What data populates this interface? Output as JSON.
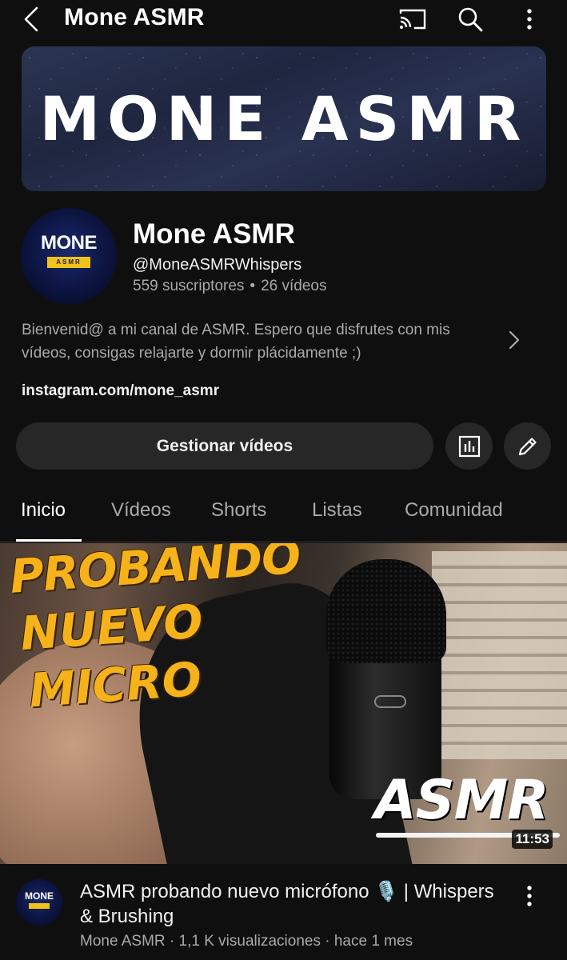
{
  "header": {
    "title": "Mone ASMR",
    "icons": [
      "back-arrow-icon",
      "cast-icon",
      "search-icon",
      "more-vertical-icon"
    ]
  },
  "banner": {
    "text": "MONE ASMR"
  },
  "channel": {
    "avatar_name": "MONE",
    "avatar_tag": "ASMR",
    "name": "Mone ASMR",
    "handle": "@MoneASMRWhispers",
    "subscribers": "559 suscriptores",
    "separator": "•",
    "videos": "26 vídeos",
    "description": "Bienvenid@ a mi canal de ASMR. Espero que disfrutes con mis vídeos, consigas relajarte y dormir plácidamente ;)",
    "link": "instagram.com/mone_asmr"
  },
  "actions": {
    "manage_label": "Gestionar vídeos",
    "icons": [
      "analytics-icon",
      "edit-pencil-icon"
    ]
  },
  "tabs": [
    {
      "label": "Inicio",
      "active": true
    },
    {
      "label": "Vídeos",
      "active": false
    },
    {
      "label": "Shorts",
      "active": false
    },
    {
      "label": "Listas",
      "active": false
    },
    {
      "label": "Comunidad",
      "active": false
    }
  ],
  "featured_video": {
    "thumb_line1": "PROBANDO",
    "thumb_line2": "NUEVO",
    "thumb_line3": "MICRO",
    "thumb_badge": "ASMR",
    "duration": "11:53",
    "title": "ASMR probando nuevo micrófono 🎙️ | Whispers & Brushing",
    "meta": "Mone ASMR · 1,1 K visualizaciones · hace 1 mes"
  },
  "colors": {
    "background": "#0f0f0f",
    "button_bg": "#272727",
    "secondary_text": "#aaaaaa",
    "thumb_title": "#f6b21b"
  }
}
